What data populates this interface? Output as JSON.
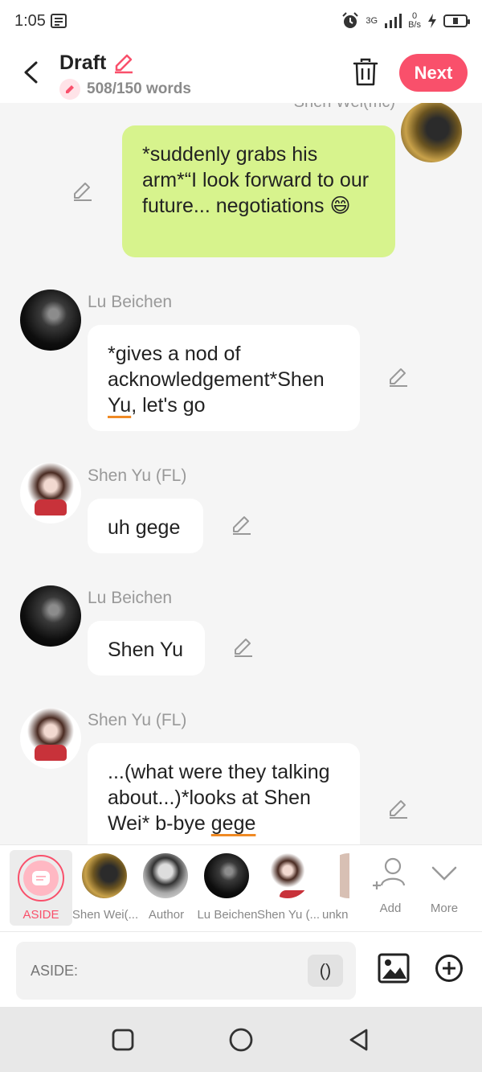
{
  "status_bar": {
    "time": "1:05",
    "speed_value": "0",
    "speed_unit": "B/s",
    "network": "3G"
  },
  "header": {
    "title": "Draft",
    "word_count": "508/150 words",
    "next_label": "Next"
  },
  "chat": {
    "cut_name": "Shen Wei(mc)",
    "messages": [
      {
        "sender": "Shen Wei(mc)",
        "parts": [
          "*suddenly grabs his arm*“I look forward to our future... negotiations",
          "😄"
        ]
      },
      {
        "sender": "Lu Beichen",
        "parts": [
          "*gives a nod of acknowledgement*Shen ",
          "Yu",
          ", let's go"
        ]
      },
      {
        "sender": "Shen Yu (FL)",
        "parts": [
          "uh gege"
        ]
      },
      {
        "sender": "Lu Beichen",
        "parts": [
          "Shen Yu"
        ]
      },
      {
        "sender": "Shen Yu (FL)",
        "parts": [
          "...(what were they talking about...)*looks at Shen Wei* b-bye ",
          "gege"
        ]
      }
    ]
  },
  "characters": {
    "aside": "ASIDE",
    "items": [
      "Shen Wei(...",
      "Author",
      "Lu Beichen",
      "Shen Yu (...",
      "unkn"
    ],
    "add_label": "Add",
    "more_label": "More"
  },
  "input": {
    "placeholder": "ASIDE:",
    "paren_label": "()"
  },
  "colors": {
    "accent": "#f9506b",
    "my_bubble": "#d7f38d",
    "underline": "#f08a24"
  },
  "icons": [
    "back-arrow-icon",
    "pencil-icon",
    "trash-icon",
    "edit-icon",
    "aside-icon",
    "add-person-icon",
    "chevron-down-icon",
    "image-icon",
    "plus-circle-icon",
    "square-nav-icon",
    "circle-nav-icon",
    "triangle-back-icon"
  ]
}
